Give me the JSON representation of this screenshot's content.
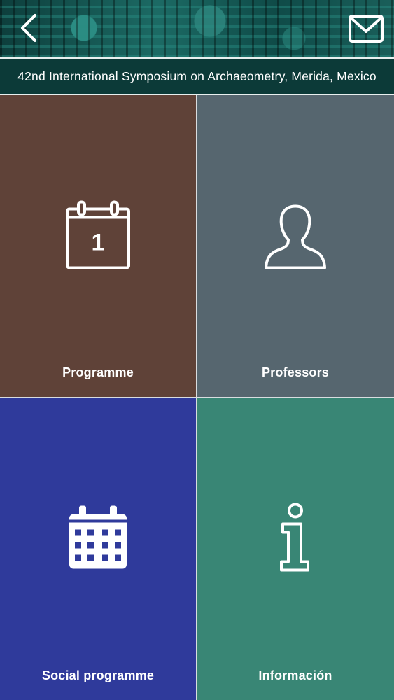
{
  "header": {
    "back_icon": "chevron-left-icon",
    "mail_icon": "envelope-icon",
    "title": "42nd International Symposium on Archaeometry, Merida, Mexico"
  },
  "tiles": [
    {
      "label": "Programme",
      "icon": "calendar-day-icon",
      "icon_text": "1",
      "color": "#5f4238"
    },
    {
      "label": "Professors",
      "icon": "person-silhouette-icon",
      "color": "#56666f"
    },
    {
      "label": "Social programme",
      "icon": "calendar-grid-icon",
      "color": "#2f3a9b"
    },
    {
      "label": "Información",
      "icon": "info-icon",
      "color": "#398675"
    }
  ]
}
